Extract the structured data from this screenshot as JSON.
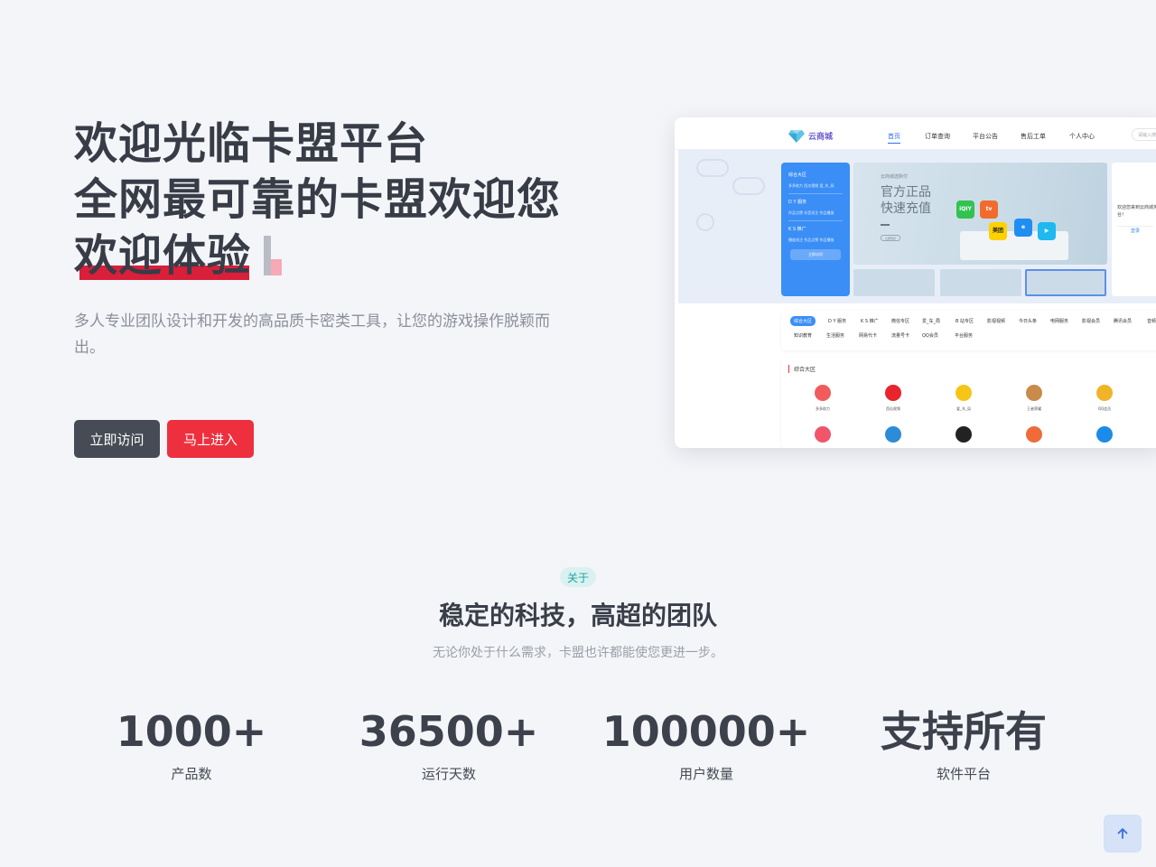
{
  "hero": {
    "title_line1": "欢迎光临卡盟平台",
    "title_line2": "全网最可靠的卡盟欢迎您",
    "title_line3": "欢迎体验",
    "description": "多人专业团队设计和开发的高品质卡密类工具，让您的游戏操作脱颖而出。",
    "buttons": {
      "visit": "立即访问",
      "enter": "马上进入"
    }
  },
  "preview": {
    "logo_text": "云商城",
    "nav": [
      "首页",
      "订单查询",
      "平台公告",
      "售后工单",
      "个人中心"
    ],
    "search_placeholder": "请输入搜索",
    "sidebar": {
      "sections": [
        {
          "title": "综合大区",
          "items": "多多助力  西瓜视频  爱_车_局"
        },
        {
          "title": "D Y 服务",
          "items": "作品点赞  抖音关注  作品播放"
        },
        {
          "title": "K S 推广",
          "items": "播放关注  作品点赞  作品播放"
        }
      ],
      "button": "立即访问"
    },
    "banner": {
      "small": "云商城选购付",
      "line1": "官方正品",
      "line2": "快速充值",
      "button": "立即购买",
      "apps": [
        "iQIY",
        "tv",
        "美团",
        "e",
        "▶"
      ]
    },
    "right_panel": {
      "welcome": "欢迎您来到云商城务平台！",
      "login": "登录"
    },
    "tags_row1": [
      "综合大区",
      "D Y 服务",
      "K S 推广",
      "微信专区",
      "爱_车_局",
      "B 站专区",
      "影视视频",
      "今日头条",
      "电网服务",
      "影视会员",
      "腾讯会员",
      "音频"
    ],
    "tags_row2": [
      "知识教育",
      "生活服务",
      "网易代卡",
      "流量号卡",
      "QQ会员",
      "平台服务"
    ],
    "category_title": "综合大区",
    "category_items": [
      {
        "label": "多多助力",
        "color": "#f25b5b"
      },
      {
        "label": "西瓜视频",
        "color": "#e8242c"
      },
      {
        "label": "爱_车_局",
        "color": "#f5c518"
      },
      {
        "label": "王者荣耀",
        "color": "#c98a4a"
      },
      {
        "label": "QQ会员",
        "color": "#f0b429"
      }
    ],
    "category_icons_row2": [
      "#f0556b",
      "#2d8bd8",
      "#222222",
      "#f06a3a",
      "#1a8ce8"
    ]
  },
  "about": {
    "badge": "关于",
    "title": "稳定的科技，高超的团队",
    "subtitle": "无论你处于什么需求，卡盟也许都能使您更进一步。"
  },
  "stats": [
    {
      "value": "1000+",
      "label": "产品数"
    },
    {
      "value": "36500+",
      "label": "运行天数"
    },
    {
      "value": "100000+",
      "label": "用户数量"
    },
    {
      "value": "支持所有",
      "label": "软件平台"
    }
  ],
  "back_to_top_icon": "arrow-up-icon",
  "colors": {
    "primary_dark": "#464b55",
    "accent_red": "#ee2f3d",
    "badge_bg": "#d9f1f1",
    "preview_blue": "#3a8ef6"
  }
}
